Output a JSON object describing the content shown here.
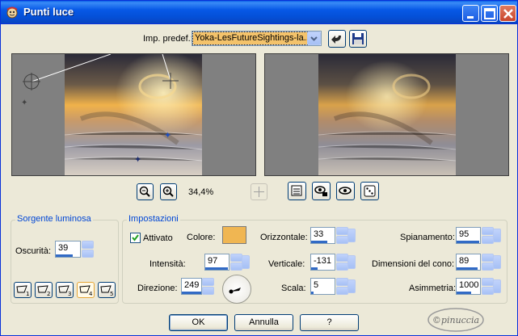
{
  "window": {
    "title": "Punti luce"
  },
  "preset": {
    "label": "Imp. predef.:",
    "value": "Yoka-LesFutureSightings-la..."
  },
  "zoom": {
    "level": "34,4%"
  },
  "light_source": {
    "title": "Sorgente luminosa",
    "darkness_label": "Oscurità:",
    "darkness_value": "39"
  },
  "settings": {
    "title": "Impostazioni",
    "enabled_label": "Attivato",
    "enabled": true,
    "color_label": "Colore:",
    "color_value": "#f0b652",
    "intensity_label": "Intensità:",
    "intensity_value": "97",
    "direction_label": "Direzione:",
    "direction_value": "249",
    "horizontal_label": "Orizzontale:",
    "horizontal_value": "33",
    "vertical_label": "Verticale:",
    "vertical_value": "-131",
    "scale_label": "Scala:",
    "scale_value": "5",
    "spread_label": "Spianamento:",
    "spread_value": "95",
    "cone_label": "Dimensioni del cono:",
    "cone_value": "89",
    "asym_label": "Asimmetria:",
    "asym_value": "1000"
  },
  "light_buttons": [
    "1",
    "2",
    "3",
    "4",
    "5"
  ],
  "buttons": {
    "ok": "OK",
    "cancel": "Annulla",
    "help": "?"
  },
  "watermark": {
    "text": "©pinuccia"
  },
  "colors": {
    "titlebar": "#0758e6",
    "dialog_bg": "#ece9d8",
    "group_title": "#0046d5",
    "accent_bar": "#316ac5"
  }
}
